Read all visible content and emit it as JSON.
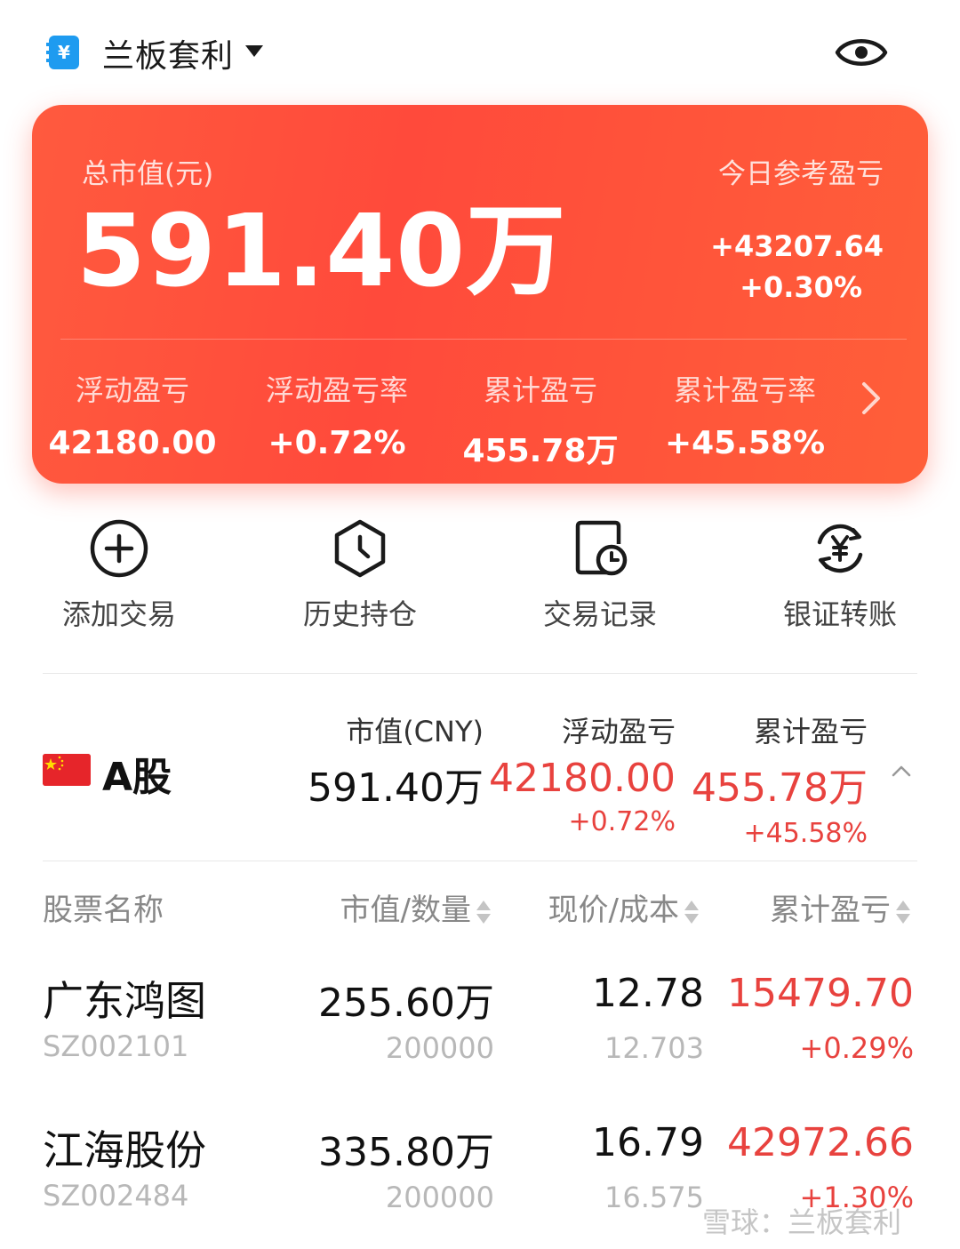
{
  "header": {
    "account_icon": "wallet-yen-icon",
    "account_icon_glyph": "¥",
    "account_name": "兰板套利",
    "dropdown_icon": "caret-down-icon",
    "visibility_icon": "eye-icon"
  },
  "summary": {
    "total_label": "总市值(元)",
    "total_value": "591.40万",
    "today_label": "今日参考盈亏",
    "today_amount": "+43207.64",
    "today_pct": "+0.30%",
    "stats": [
      {
        "label": "浮动盈亏",
        "value": "42180.00"
      },
      {
        "label": "浮动盈亏率",
        "value": "+0.72%"
      },
      {
        "label": "累计盈亏",
        "value": "455.78万"
      },
      {
        "label": "累计盈亏率",
        "value": "+45.58%"
      }
    ],
    "more_icon": "chevron-right-icon"
  },
  "actions": [
    {
      "label": "添加交易",
      "icon": "plus-circle-icon"
    },
    {
      "label": "历史持仓",
      "icon": "clock-hexagon-icon"
    },
    {
      "label": "交易记录",
      "icon": "record-clock-icon"
    },
    {
      "label": "银证转账",
      "icon": "yen-transfer-icon"
    }
  ],
  "market": {
    "flag_icon": "china-flag-icon",
    "name": "A股",
    "mv_label": "市值(CNY)",
    "mv_value": "591.40万",
    "float_label": "浮动盈亏",
    "float_value": "42180.00",
    "float_pct": "+0.72%",
    "cum_label": "累计盈亏",
    "cum_value": "455.78万",
    "cum_pct": "+45.58%",
    "collapse_icon": "chevron-up-icon"
  },
  "table": {
    "headers": [
      "股票名称",
      "市值/数量",
      "现价/成本",
      "累计盈亏"
    ],
    "rows": [
      {
        "name": "广东鸿图",
        "code": "SZ002101",
        "market_value": "255.60万",
        "quantity": "200000",
        "price": "12.78",
        "cost": "12.703",
        "pl": "15479.70",
        "pl_pct": "+0.29%"
      },
      {
        "name": "江海股份",
        "code": "SZ002484",
        "market_value": "335.80万",
        "quantity": "200000",
        "price": "16.79",
        "cost": "16.575",
        "pl": "42972.66",
        "pl_pct": "+1.30%"
      }
    ]
  },
  "colors": {
    "accent_red": "#ff4f3b",
    "gain_red": "#e8423e",
    "icon_blue": "#1e9bf0"
  },
  "watermark": "雪球：兰板套利"
}
